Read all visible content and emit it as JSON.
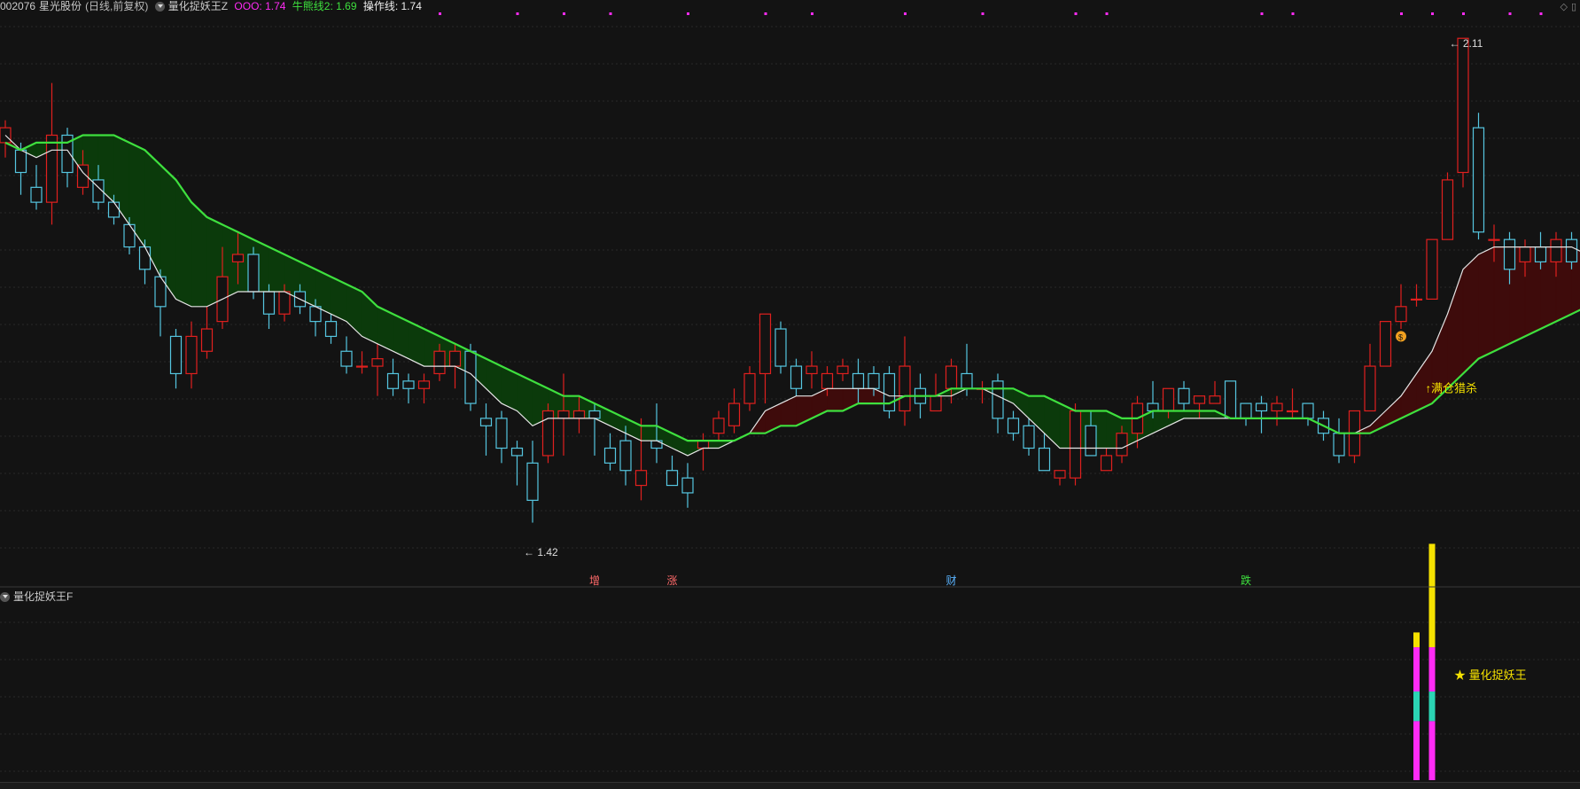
{
  "header": {
    "stock_code": "002076",
    "stock_name": "星光股份",
    "period": "(日线,前复权)",
    "indicator_name": "量化捉妖王Z",
    "ooo_label": "OOO: 1.74",
    "bull_label": "牛熊线2: 1.69",
    "op_label": "操作线: 1.74",
    "corner_icons": [
      "diamond-icon",
      "restore-icon"
    ]
  },
  "colors": {
    "up": "#e0201e",
    "down": "#55c6e0",
    "green_line": "#3ee03e",
    "white_line": "#e6e6e6",
    "green_fill": "#0b3a0b",
    "red_fill": "#3e0b0b",
    "magenta": "#ff2bf5",
    "yellow": "#f5e100",
    "teal": "#2bd4b4"
  },
  "main_chart": {
    "high_annotation": "2.11",
    "low_annotation": "1.42",
    "signal_text": "↑满仓猎杀",
    "markers": [
      "增",
      "涨",
      "财",
      "跌"
    ],
    "money_icon": "money-bag-icon"
  },
  "sub_chart": {
    "title": "量化捉妖王F",
    "legend": "★ 量化捉妖王"
  },
  "chart_data": {
    "type": "candlestick",
    "ylim": [
      1.4,
      2.14
    ],
    "candles": [
      [
        1.97,
        1.99,
        1.95,
        2.0
      ],
      [
        1.96,
        1.93,
        1.9,
        1.97
      ],
      [
        1.91,
        1.89,
        1.88,
        1.94
      ],
      [
        1.89,
        1.98,
        1.86,
        2.05
      ],
      [
        1.98,
        1.93,
        1.91,
        1.99
      ],
      [
        1.91,
        1.94,
        1.9,
        1.96
      ],
      [
        1.92,
        1.89,
        1.88,
        1.94
      ],
      [
        1.89,
        1.87,
        1.86,
        1.9
      ],
      [
        1.86,
        1.83,
        1.82,
        1.87
      ],
      [
        1.83,
        1.8,
        1.78,
        1.84
      ],
      [
        1.79,
        1.75,
        1.71,
        1.8
      ],
      [
        1.71,
        1.66,
        1.64,
        1.72
      ],
      [
        1.66,
        1.71,
        1.64,
        1.73
      ],
      [
        1.69,
        1.72,
        1.68,
        1.75
      ],
      [
        1.73,
        1.79,
        1.72,
        1.83
      ],
      [
        1.81,
        1.82,
        1.78,
        1.85
      ],
      [
        1.82,
        1.77,
        1.76,
        1.83
      ],
      [
        1.77,
        1.74,
        1.72,
        1.78
      ],
      [
        1.74,
        1.77,
        1.73,
        1.78
      ],
      [
        1.77,
        1.75,
        1.74,
        1.78
      ],
      [
        1.75,
        1.73,
        1.71,
        1.76
      ],
      [
        1.73,
        1.71,
        1.7,
        1.74
      ],
      [
        1.69,
        1.67,
        1.66,
        1.71
      ],
      [
        1.67,
        1.67,
        1.66,
        1.69
      ],
      [
        1.67,
        1.68,
        1.63,
        1.7
      ],
      [
        1.66,
        1.64,
        1.63,
        1.68
      ],
      [
        1.65,
        1.64,
        1.62,
        1.66
      ],
      [
        1.64,
        1.65,
        1.62,
        1.66
      ],
      [
        1.66,
        1.69,
        1.65,
        1.7
      ],
      [
        1.67,
        1.69,
        1.64,
        1.7
      ],
      [
        1.69,
        1.62,
        1.61,
        1.7
      ],
      [
        1.6,
        1.59,
        1.55,
        1.62
      ],
      [
        1.6,
        1.56,
        1.54,
        1.61
      ],
      [
        1.56,
        1.55,
        1.51,
        1.57
      ],
      [
        1.54,
        1.49,
        1.46,
        1.57
      ],
      [
        1.55,
        1.61,
        1.54,
        1.62
      ],
      [
        1.6,
        1.61,
        1.55,
        1.66
      ],
      [
        1.6,
        1.61,
        1.58,
        1.63
      ],
      [
        1.61,
        1.6,
        1.55,
        1.62
      ],
      [
        1.56,
        1.54,
        1.53,
        1.58
      ],
      [
        1.57,
        1.53,
        1.51,
        1.59
      ],
      [
        1.51,
        1.53,
        1.49,
        1.6
      ],
      [
        1.57,
        1.56,
        1.54,
        1.62
      ],
      [
        1.53,
        1.51,
        1.51,
        1.55
      ],
      [
        1.52,
        1.5,
        1.48,
        1.54
      ],
      [
        1.56,
        1.57,
        1.53,
        1.58
      ],
      [
        1.58,
        1.6,
        1.57,
        1.61
      ],
      [
        1.59,
        1.62,
        1.58,
        1.64
      ],
      [
        1.62,
        1.66,
        1.61,
        1.67
      ],
      [
        1.66,
        1.74,
        1.62,
        1.74
      ],
      [
        1.72,
        1.67,
        1.66,
        1.73
      ],
      [
        1.67,
        1.64,
        1.63,
        1.68
      ],
      [
        1.66,
        1.67,
        1.64,
        1.69
      ],
      [
        1.64,
        1.66,
        1.63,
        1.67
      ],
      [
        1.66,
        1.67,
        1.65,
        1.68
      ],
      [
        1.66,
        1.64,
        1.62,
        1.68
      ],
      [
        1.66,
        1.64,
        1.63,
        1.67
      ],
      [
        1.66,
        1.61,
        1.6,
        1.67
      ],
      [
        1.61,
        1.67,
        1.59,
        1.71
      ],
      [
        1.64,
        1.62,
        1.6,
        1.66
      ],
      [
        1.61,
        1.63,
        1.61,
        1.66
      ],
      [
        1.64,
        1.67,
        1.62,
        1.68
      ],
      [
        1.66,
        1.64,
        1.63,
        1.7
      ],
      [
        1.64,
        1.64,
        1.62,
        1.65
      ],
      [
        1.65,
        1.6,
        1.58,
        1.66
      ],
      [
        1.6,
        1.58,
        1.57,
        1.61
      ],
      [
        1.59,
        1.56,
        1.55,
        1.6
      ],
      [
        1.56,
        1.53,
        1.53,
        1.58
      ],
      [
        1.52,
        1.53,
        1.51,
        1.53
      ],
      [
        1.52,
        1.61,
        1.51,
        1.62
      ],
      [
        1.59,
        1.55,
        1.55,
        1.61
      ],
      [
        1.53,
        1.55,
        1.53,
        1.56
      ],
      [
        1.55,
        1.58,
        1.54,
        1.59
      ],
      [
        1.58,
        1.62,
        1.56,
        1.63
      ],
      [
        1.62,
        1.61,
        1.6,
        1.65
      ],
      [
        1.61,
        1.64,
        1.6,
        1.64
      ],
      [
        1.64,
        1.62,
        1.61,
        1.65
      ],
      [
        1.62,
        1.63,
        1.6,
        1.63
      ],
      [
        1.62,
        1.63,
        1.62,
        1.65
      ],
      [
        1.65,
        1.6,
        1.6,
        1.65
      ],
      [
        1.62,
        1.6,
        1.59,
        1.62
      ],
      [
        1.62,
        1.61,
        1.58,
        1.63
      ],
      [
        1.61,
        1.62,
        1.59,
        1.63
      ],
      [
        1.61,
        1.61,
        1.6,
        1.64
      ],
      [
        1.62,
        1.6,
        1.59,
        1.62
      ],
      [
        1.6,
        1.58,
        1.57,
        1.61
      ],
      [
        1.58,
        1.55,
        1.54,
        1.6
      ],
      [
        1.55,
        1.61,
        1.54,
        1.61
      ],
      [
        1.61,
        1.67,
        1.61,
        1.7
      ],
      [
        1.67,
        1.73,
        1.68,
        1.73
      ],
      [
        1.73,
        1.75,
        1.72,
        1.78
      ],
      [
        1.76,
        1.76,
        1.75,
        1.78
      ],
      [
        1.76,
        1.84,
        1.76,
        1.84
      ],
      [
        1.84,
        1.92,
        1.9,
        1.93
      ],
      [
        1.93,
        2.11,
        1.91,
        2.11
      ],
      [
        1.99,
        1.85,
        1.84,
        2.01
      ],
      [
        1.84,
        1.84,
        1.81,
        1.86
      ],
      [
        1.84,
        1.8,
        1.78,
        1.85
      ],
      [
        1.81,
        1.83,
        1.79,
        1.84
      ],
      [
        1.83,
        1.81,
        1.8,
        1.85
      ],
      [
        1.81,
        1.84,
        1.79,
        1.85
      ],
      [
        1.84,
        1.81,
        1.8,
        1.85
      ],
      [
        1.8,
        1.82,
        1.79,
        1.83
      ]
    ],
    "series": [
      {
        "name": "OOO",
        "color": "white_line",
        "values": [
          1.98,
          1.96,
          1.95,
          1.96,
          1.96,
          1.93,
          1.91,
          1.89,
          1.86,
          1.83,
          1.79,
          1.76,
          1.75,
          1.75,
          1.76,
          1.77,
          1.77,
          1.77,
          1.77,
          1.76,
          1.75,
          1.74,
          1.73,
          1.71,
          1.7,
          1.69,
          1.68,
          1.67,
          1.67,
          1.67,
          1.66,
          1.64,
          1.62,
          1.61,
          1.59,
          1.6,
          1.6,
          1.6,
          1.6,
          1.59,
          1.58,
          1.57,
          1.57,
          1.56,
          1.55,
          1.56,
          1.56,
          1.57,
          1.58,
          1.61,
          1.62,
          1.63,
          1.63,
          1.64,
          1.64,
          1.64,
          1.64,
          1.63,
          1.63,
          1.63,
          1.63,
          1.63,
          1.64,
          1.64,
          1.63,
          1.62,
          1.6,
          1.58,
          1.56,
          1.56,
          1.56,
          1.56,
          1.56,
          1.57,
          1.58,
          1.59,
          1.6,
          1.6,
          1.6,
          1.6,
          1.6,
          1.6,
          1.6,
          1.6,
          1.6,
          1.59,
          1.58,
          1.58,
          1.59,
          1.61,
          1.63,
          1.66,
          1.69,
          1.74,
          1.8,
          1.82,
          1.83,
          1.83,
          1.83,
          1.83,
          1.83,
          1.83,
          1.82
        ]
      },
      {
        "name": "牛熊线2",
        "color": "green_line",
        "values": [
          1.97,
          1.96,
          1.97,
          1.97,
          1.97,
          1.98,
          1.98,
          1.98,
          1.97,
          1.96,
          1.94,
          1.92,
          1.89,
          1.87,
          1.86,
          1.85,
          1.84,
          1.83,
          1.82,
          1.81,
          1.8,
          1.79,
          1.78,
          1.77,
          1.75,
          1.74,
          1.73,
          1.72,
          1.71,
          1.7,
          1.69,
          1.68,
          1.67,
          1.66,
          1.65,
          1.64,
          1.63,
          1.63,
          1.62,
          1.61,
          1.6,
          1.59,
          1.59,
          1.58,
          1.57,
          1.57,
          1.57,
          1.57,
          1.58,
          1.58,
          1.59,
          1.59,
          1.6,
          1.61,
          1.61,
          1.62,
          1.62,
          1.62,
          1.63,
          1.63,
          1.63,
          1.64,
          1.64,
          1.64,
          1.64,
          1.64,
          1.63,
          1.63,
          1.62,
          1.61,
          1.61,
          1.61,
          1.6,
          1.6,
          1.61,
          1.61,
          1.61,
          1.61,
          1.61,
          1.6,
          1.6,
          1.6,
          1.6,
          1.6,
          1.6,
          1.59,
          1.58,
          1.58,
          1.58,
          1.59,
          1.6,
          1.61,
          1.62,
          1.64,
          1.66,
          1.68,
          1.69,
          1.7,
          1.71,
          1.72,
          1.73,
          1.74,
          1.75
        ]
      }
    ],
    "sub_bars": [
      {
        "index": 91,
        "stack": [
          {
            "color": "magenta",
            "value": 0.4
          },
          {
            "color": "teal",
            "value": 0.2
          },
          {
            "color": "magenta",
            "value": 0.3
          },
          {
            "color": "yellow",
            "value": 0.1
          }
        ]
      },
      {
        "index": 92,
        "stack": [
          {
            "color": "magenta",
            "value": 0.4
          },
          {
            "color": "teal",
            "value": 0.2
          },
          {
            "color": "magenta",
            "value": 0.3
          },
          {
            "color": "yellow",
            "value": 0.7
          }
        ]
      }
    ]
  }
}
